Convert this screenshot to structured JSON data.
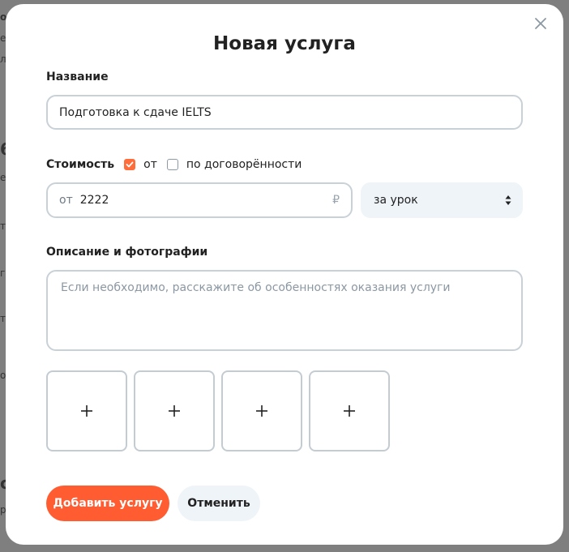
{
  "background": {
    "fragments": [
      "o",
      "e",
      "л",
      "6",
      "ер",
      "т",
      "г с",
      "т",
      "об",
      "с",
      "р"
    ]
  },
  "modal": {
    "title": "Новая услуга",
    "close_icon": "close-icon"
  },
  "name_field": {
    "label": "Название",
    "value": "Подготовка к сдаче IELTS"
  },
  "price": {
    "label": "Стоимость",
    "from_checkbox": {
      "label": "от",
      "checked": true
    },
    "negotiable_checkbox": {
      "label": "по договорённости",
      "checked": false
    },
    "prefix": "от",
    "value": "2222",
    "currency": "₽",
    "unit": "за урок"
  },
  "description": {
    "label": "Описание и фотографии",
    "placeholder": "Если необходимо, расскажите об особенностях оказания услуги"
  },
  "photos": {
    "slots": [
      "+",
      "+",
      "+",
      "+"
    ]
  },
  "actions": {
    "submit_label": "Добавить услугу",
    "cancel_label": "Отменить"
  },
  "colors": {
    "accent": "#ff5c32",
    "border": "#c9d1d8",
    "secondary_bg": "#eff4f8"
  }
}
